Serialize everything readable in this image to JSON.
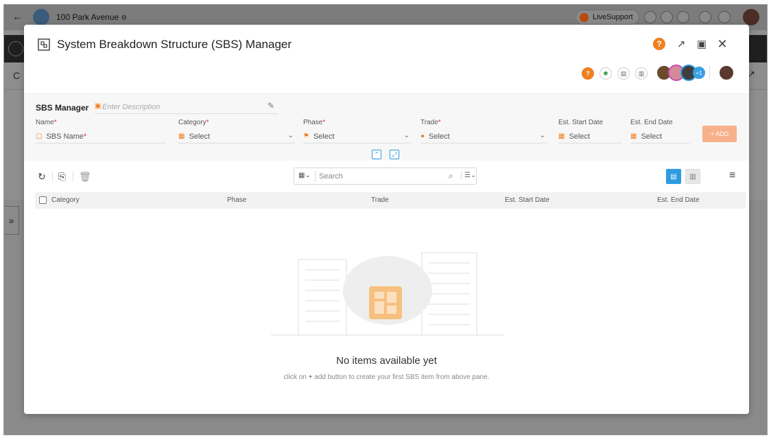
{
  "background": {
    "project_name": "100 Park Avenue",
    "live_support": "LiveSupport",
    "row_letter": "C"
  },
  "modal": {
    "title": "System Breakdown Structure (SBS) Manager",
    "help_symbol": "?",
    "avatar_more": "+1"
  },
  "form": {
    "section_title": "SBS Manager",
    "description_placeholder": "Enter Description",
    "fields": {
      "name": {
        "label": "Name",
        "placeholder": "SBS Name"
      },
      "category": {
        "label": "Category",
        "value": "Select"
      },
      "phase": {
        "label": "Phase",
        "value": "Select"
      },
      "trade": {
        "label": "Trade",
        "value": "Select"
      },
      "est_start": {
        "label": "Est. Start Date",
        "value": "Select"
      },
      "est_end": {
        "label": "Est. End Date",
        "value": "Select"
      }
    },
    "required_mark": "*",
    "add_button": "+ ADD"
  },
  "toolbar": {
    "search_placeholder": "Search"
  },
  "table": {
    "columns": [
      "Category",
      "Phase",
      "Trade",
      "Est. Start Date",
      "Est. End Date"
    ]
  },
  "empty_state": {
    "title": "No items available yet",
    "subtitle_prefix": "click on ",
    "subtitle_plus": "+",
    "subtitle_rest": " add button to create your first SBS item from above pane."
  },
  "colors": {
    "accent_blue": "#2d9be0",
    "accent_orange": "#f07f20",
    "required_red": "#e5312b"
  }
}
